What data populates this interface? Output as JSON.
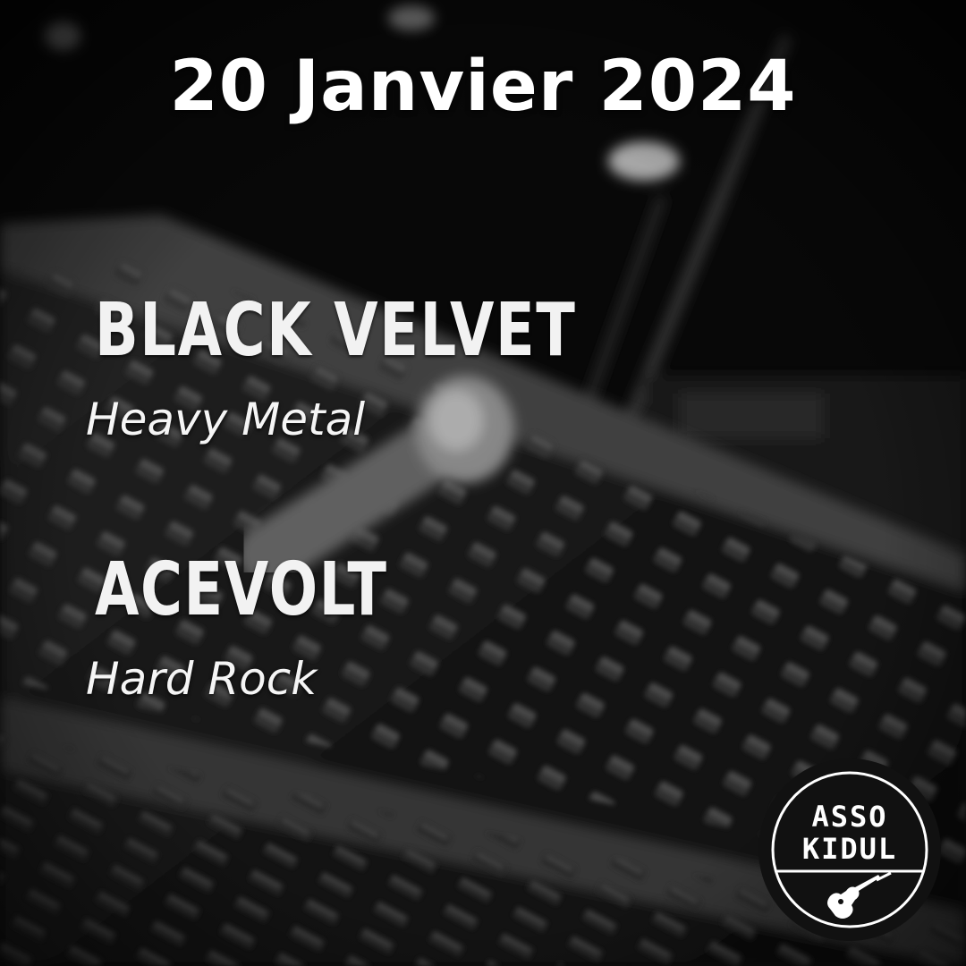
{
  "event": {
    "date": "20 Janvier 2024"
  },
  "bands": [
    {
      "name": "BLACK VELVET",
      "genre": "Heavy Metal"
    },
    {
      "name": "ACEVOLT",
      "genre": "Hard Rock"
    }
  ],
  "logo": {
    "line1": "ASSO",
    "line2": "KIDUL",
    "icon": "guitar-icon"
  },
  "colors": {
    "text": "#ffffff",
    "background": "#0b0b0b",
    "logo_bg": "#111111"
  }
}
